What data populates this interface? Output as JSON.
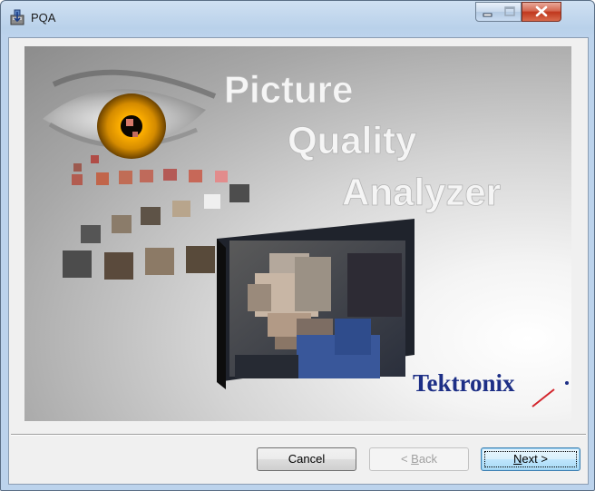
{
  "window": {
    "title": "PQA"
  },
  "banner": {
    "line1": "Picture",
    "line2": "Quality",
    "line3": "Analyzer",
    "logo_text": "Tektronix"
  },
  "buttons": {
    "cancel": "Cancel",
    "back_prefix": "< ",
    "back_accel": "B",
    "back_rest": "ack",
    "next_accel": "N",
    "next_rest": "ext >"
  },
  "colors": {
    "logo_blue": "#1d2f86",
    "logo_red": "#d3252c",
    "focus_border": "#3c7fb1"
  }
}
